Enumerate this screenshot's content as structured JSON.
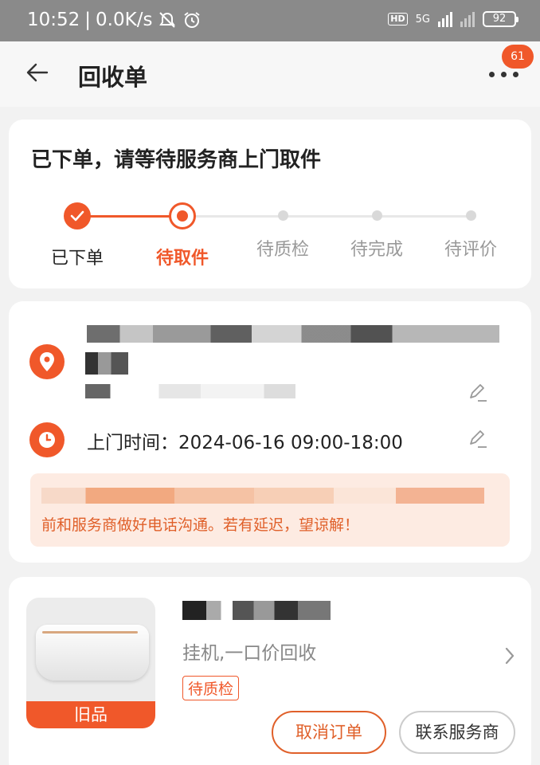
{
  "status_bar": {
    "time": "10:52",
    "speed": "0.0K/s",
    "hd": "HD",
    "network": "5G",
    "battery": "92"
  },
  "nav": {
    "title": "回收单",
    "badge": "61"
  },
  "status_card": {
    "title": "已下单，请等待服务商上门取件",
    "steps": [
      {
        "label": "已下单",
        "state": "done"
      },
      {
        "label": "待取件",
        "state": "current"
      },
      {
        "label": "待质检",
        "state": "todo"
      },
      {
        "label": "待完成",
        "state": "todo"
      },
      {
        "label": "待评价",
        "state": "todo"
      }
    ],
    "colors": {
      "accent": "#f0582a",
      "inactive": "#999999"
    }
  },
  "address_card": {
    "visit_time": "上门时间：2024-06-16 09:00-18:00",
    "notice": "前和服务商做好电话沟通。若有延迟，望谅解！"
  },
  "product_card": {
    "thumb_tag": "旧品",
    "subtitle": "挂机,一口价回收",
    "status_badge": "待质检",
    "cancel_label": "取消订单",
    "contact_label": "联系服务商"
  }
}
